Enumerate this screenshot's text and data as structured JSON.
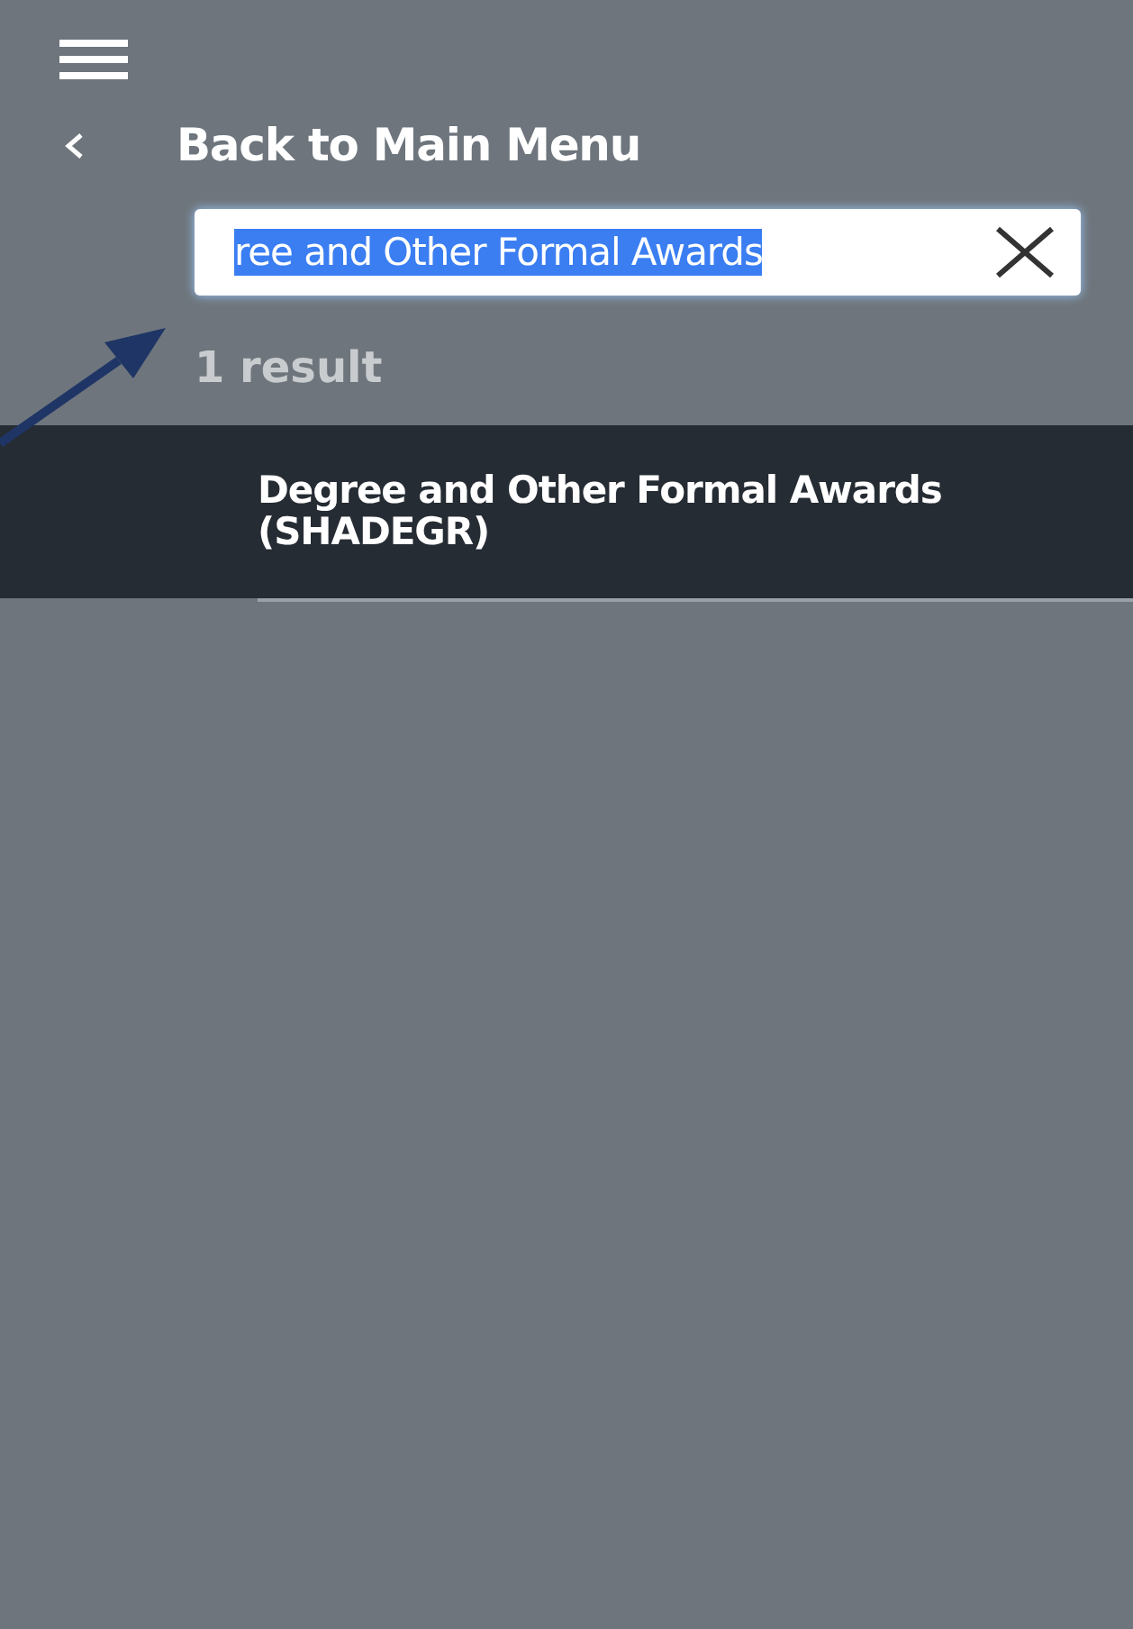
{
  "back_link": {
    "label": "Back to Main Menu"
  },
  "search": {
    "value": "ree and Other Formal Awards",
    "text_selected": true
  },
  "result_count": "1 result",
  "results": [
    {
      "label": "Degree and Other Formal Awards (SHADEGR)",
      "selected": true
    }
  ]
}
